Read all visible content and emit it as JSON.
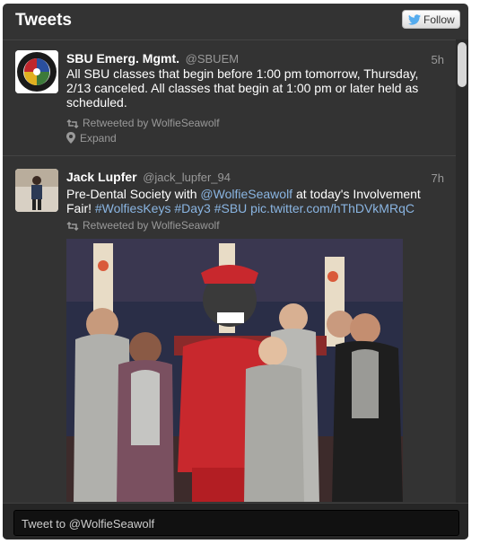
{
  "header": {
    "title": "Tweets",
    "follow_label": "Follow"
  },
  "tweets": [
    {
      "name": "SBU Emerg. Mgmt.",
      "handle": "@SBUEM",
      "time": "5h",
      "text": "All SBU classes that begin before 1:00 pm tomorrow, Thursday, 2/13 canceled. All classes that begin at 1:00 pm or later held as scheduled.",
      "retweeted_by": "Retweeted by WolfieSeawolf",
      "expand_label": "Expand"
    },
    {
      "name": "Jack Lupfer",
      "handle": "@jack_lupfer_94",
      "time": "7h",
      "text_before": "Pre-Dental Society with ",
      "mention": "@WolfieSeawolf",
      "text_after": " at today's Involvement Fair! ",
      "hashtags": "#WolfiesKeys #Day3 #SBU",
      "pic_link": "pic.twitter.com/hThDVkMRqC",
      "retweeted_by": "Retweeted by WolfieSeawolf"
    }
  ],
  "composer": {
    "placeholder": "Tweet to @WolfieSeawolf"
  },
  "colors": {
    "widget_bg": "#333333",
    "link": "#8ab5e2",
    "twitter_blue": "#55acee"
  }
}
